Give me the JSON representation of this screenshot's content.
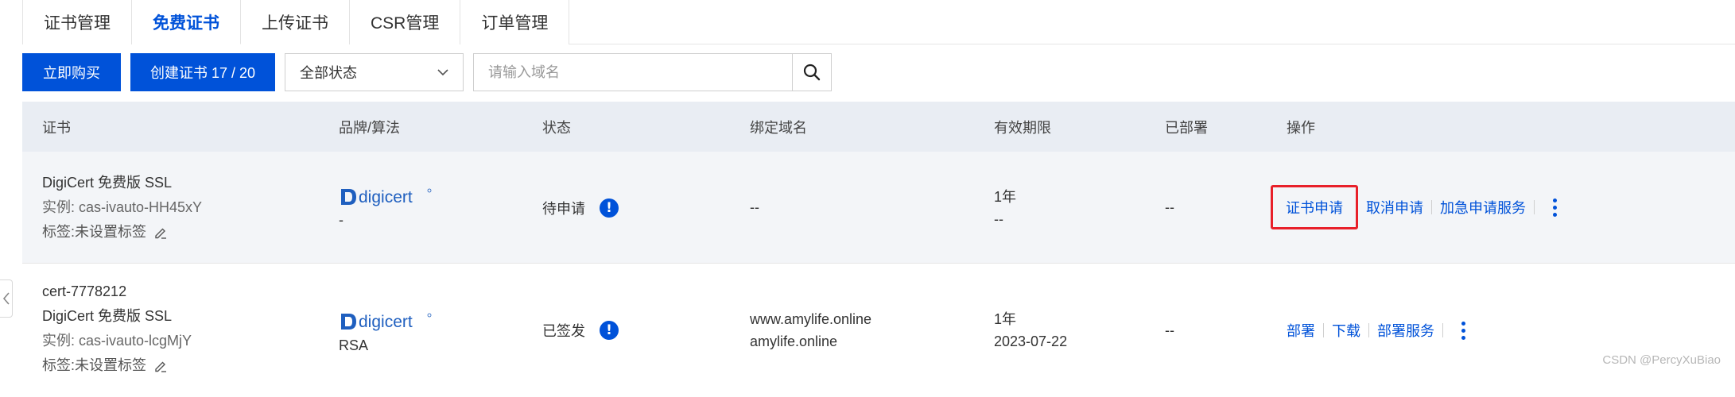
{
  "tabs": [
    {
      "label": "证书管理"
    },
    {
      "label": "免费证书"
    },
    {
      "label": "上传证书"
    },
    {
      "label": "CSR管理"
    },
    {
      "label": "订单管理"
    }
  ],
  "active_tab": "免费证书",
  "toolbar": {
    "buy_label": "立即购买",
    "create_label": "创建证书 17 / 20",
    "status_select": "全部状态",
    "search_placeholder": "请输入域名"
  },
  "table": {
    "headers": {
      "cert": "证书",
      "brand": "品牌/算法",
      "status": "状态",
      "domain": "绑定域名",
      "validity": "有效期限",
      "deployed": "已部署",
      "actions": "操作"
    },
    "rows": [
      {
        "cert_name": "DigiCert 免费版 SSL",
        "instance": "实例: cas-ivauto-HH45xY",
        "tag": "标签:未设置标签",
        "brand_logo": "digicert",
        "algorithm": "-",
        "status": "待申请",
        "domain_1": "--",
        "validity": "1年",
        "expiry": "--",
        "deployed": "--",
        "actions": [
          "证书申请",
          "取消申请",
          "加急申请服务"
        ]
      },
      {
        "cert_id": "cert-7778212",
        "cert_name": "DigiCert 免费版 SSL",
        "instance": "实例: cas-ivauto-lcgMjY",
        "tag": "标签:未设置标签",
        "brand_logo": "digicert",
        "algorithm": "RSA",
        "status": "已签发",
        "domain_1": "www.amylife.online",
        "domain_2": "amylife.online",
        "validity": "1年",
        "expiry": "2023-07-22",
        "deployed": "--",
        "actions": [
          "部署",
          "下载",
          "部署服务"
        ]
      }
    ]
  },
  "watermark": "CSDN @PercyXuBiao",
  "colors": {
    "primary": "#0052d9",
    "highlight": "#e8202a",
    "header_bg": "#e9edf3"
  }
}
